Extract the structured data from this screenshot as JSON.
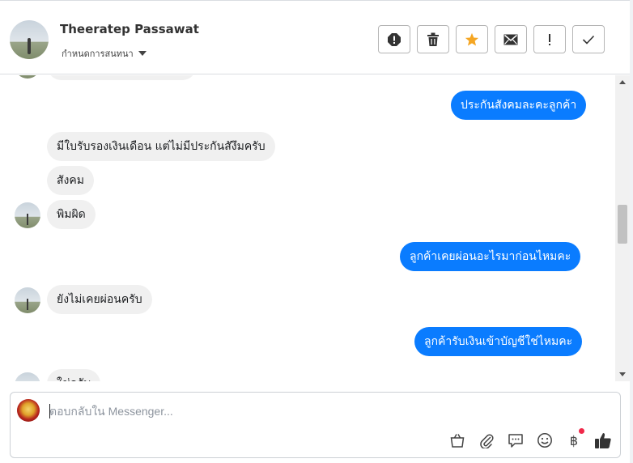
{
  "header": {
    "contact_name": "Theeratep Passawat",
    "label_select": "กำหนดการสนทนา",
    "toolbar": [
      {
        "icon": "spam-alert-icon"
      },
      {
        "icon": "trash-icon"
      },
      {
        "icon": "star-icon",
        "color": "#f5a623"
      },
      {
        "icon": "mail-icon"
      },
      {
        "icon": "follow-up-icon"
      },
      {
        "icon": "check-done-icon"
      }
    ]
  },
  "messages": [
    {
      "side": "out",
      "text": "ประกันสังคมละคะลูกค้า"
    },
    {
      "side": "in",
      "text": "มีใบรับรองเงินเดือน แต่ไม่มีประกันสังึมครับ"
    },
    {
      "side": "in",
      "text": "สังคม"
    },
    {
      "side": "in",
      "text": "พิมผิด"
    },
    {
      "side": "out",
      "text": "ลูกค้าเคยผ่อนอะไรมาก่อนไหมคะ"
    },
    {
      "side": "in",
      "text": "ยังไม่เคยผ่อนครับ"
    },
    {
      "side": "out",
      "text": "ลูกค้ารับเงินเข้าบัญชีใช่ไหมคะ"
    },
    {
      "side": "in",
      "text": "ใช่ครับ"
    }
  ],
  "composer": {
    "placeholder": "ตอบกลับใน Messenger...",
    "baht_symbol": "฿",
    "tools": [
      "bag-icon",
      "attachment-icon",
      "saved-replies-icon",
      "emoji-icon",
      "payment-icon",
      "like-icon"
    ]
  },
  "colors": {
    "outgoing_bubble": "#0a7cff",
    "incoming_bubble": "#f0f0f0",
    "notification_dot": "#f02849"
  }
}
